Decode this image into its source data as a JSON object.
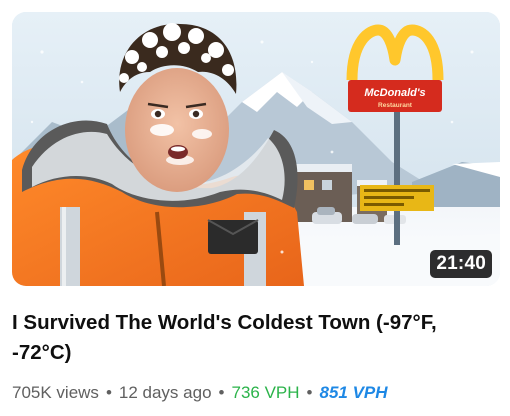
{
  "video": {
    "title": "I Survived The World's Coldest Town (-97°F, -72°C)",
    "duration": "21:40",
    "views": "705K views",
    "age": "12 days ago",
    "vph": "736 VPH",
    "vph_alt": "851 VPH",
    "separator": "•"
  },
  "thumbnail": {
    "sign_brand": "McDonald's",
    "sign_sub": "Restaurant",
    "colors": {
      "arches": "#ffc72c",
      "sign_red": "#d52b1e",
      "jacket": "#f47b20",
      "sky": "#dbe8f2"
    }
  },
  "colors": {
    "title": "#0f0f0f",
    "meta": "#606060",
    "vph": "#2bb34a",
    "vph_alt": "#1e88e5"
  }
}
